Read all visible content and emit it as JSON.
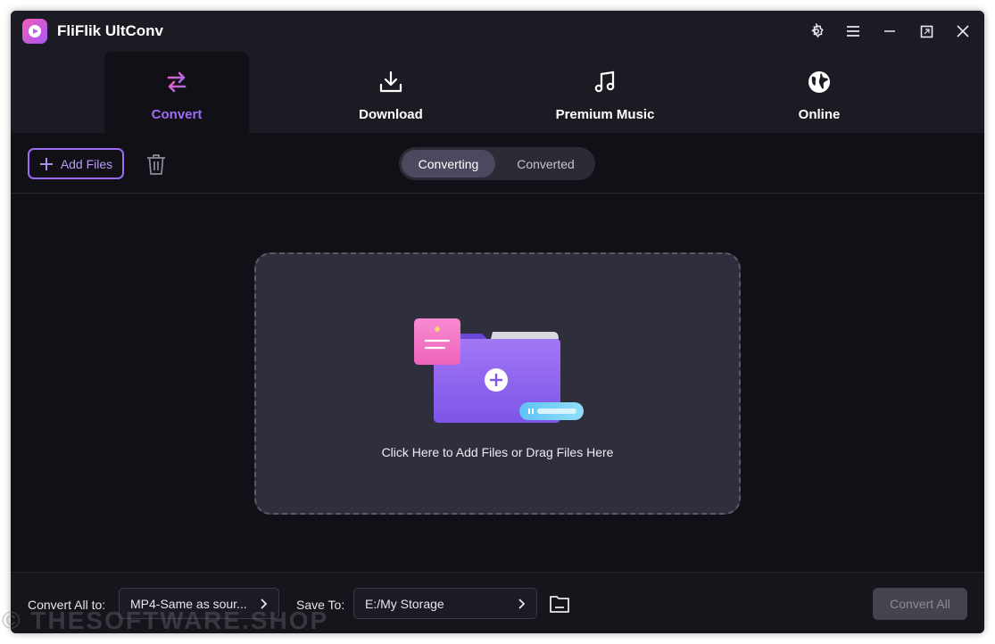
{
  "app": {
    "title": "FliFlik UltConv"
  },
  "nav": {
    "tabs": [
      {
        "label": "Convert",
        "icon": "convert-arrows-icon",
        "active": true
      },
      {
        "label": "Download",
        "icon": "download-icon",
        "active": false
      },
      {
        "label": "Premium Music",
        "icon": "music-note-icon",
        "active": false
      },
      {
        "label": "Online",
        "icon": "globe-icon",
        "active": false
      }
    ]
  },
  "toolbar": {
    "add_files_label": "Add Files",
    "segments": [
      {
        "label": "Converting",
        "active": true
      },
      {
        "label": "Converted",
        "active": false
      }
    ]
  },
  "dropzone": {
    "text": "Click Here to Add Files or Drag Files Here"
  },
  "bottom": {
    "convert_all_to_label": "Convert All to:",
    "format_value": "MP4-Same as sour...",
    "save_to_label": "Save To:",
    "save_path": "E:/My Storage",
    "convert_all_button": "Convert All"
  },
  "watermark": "© THESOFTWARE.SHOP",
  "colors": {
    "accent": "#9a6cf2",
    "background": "#111017",
    "titlebar": "#1c1b23"
  }
}
